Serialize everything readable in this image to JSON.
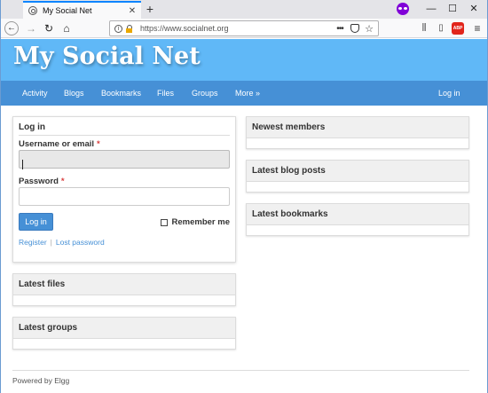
{
  "browser": {
    "tab_title": "My Social Net",
    "tab_close": "✕",
    "new_tab": "+",
    "url": "https://www.socialnet.org",
    "url_menu": "•••",
    "adblock_label": "ABP",
    "window_controls": {
      "minimize": "—",
      "maximize": "☐",
      "close": "✕"
    },
    "private_indicator_color": "#8000d7"
  },
  "site": {
    "title": "My Social Net",
    "header_color": "#60b8f7",
    "nav_color": "#4690d6",
    "nav": [
      {
        "label": "Activity"
      },
      {
        "label": "Blogs"
      },
      {
        "label": "Bookmarks"
      },
      {
        "label": "Files"
      },
      {
        "label": "Groups"
      },
      {
        "label": "More »"
      }
    ],
    "login_link": "Log in"
  },
  "login": {
    "title": "Log in",
    "username_label": "Username or email",
    "password_label": "Password",
    "required_mark": "*",
    "submit_label": "Log in",
    "remember_label": "Remember me",
    "register_link": "Register",
    "link_separator": "|",
    "lost_password_link": "Lost password"
  },
  "modules": {
    "latest_files": "Latest files",
    "latest_groups": "Latest groups",
    "newest_members": "Newest members",
    "latest_blog_posts": "Latest blog posts",
    "latest_bookmarks": "Latest bookmarks"
  },
  "footer": {
    "text": "Powered by Elgg"
  }
}
